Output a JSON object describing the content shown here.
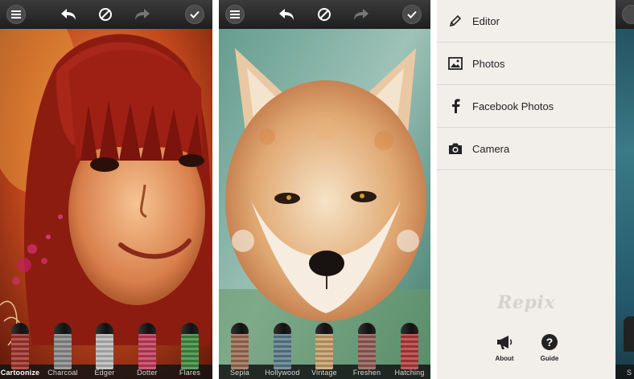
{
  "screens": {
    "cartoonize": {
      "brushes": [
        {
          "label": "Cartoonize",
          "active": true,
          "color": "#a0332a"
        },
        {
          "label": "Charcoal",
          "active": false,
          "color": "#8a8a8a"
        },
        {
          "label": "Edger",
          "active": false,
          "color": "#b8b8b8"
        },
        {
          "label": "Dotter",
          "active": false,
          "color": "#c23b5a"
        },
        {
          "label": "Flares",
          "active": false,
          "color": "#3f8b3e"
        }
      ]
    },
    "fox": {
      "brushes": [
        {
          "label": "Sepia",
          "active": false,
          "color": "#9a6b52"
        },
        {
          "label": "Hollywood",
          "active": false,
          "color": "#5a7a8c"
        },
        {
          "label": "Vintage",
          "active": false,
          "color": "#c6a06a"
        },
        {
          "label": "Freshen",
          "active": false,
          "color": "#8f5d54"
        },
        {
          "label": "Hatching",
          "active": false,
          "color": "#b03a3a"
        }
      ]
    }
  },
  "menu": {
    "items": [
      {
        "label": "Editor",
        "icon": "pencil-icon"
      },
      {
        "label": "Photos",
        "icon": "image-icon"
      },
      {
        "label": "Facebook Photos",
        "icon": "facebook-icon"
      },
      {
        "label": "Camera",
        "icon": "camera-icon"
      }
    ],
    "brand": "Repix",
    "about_label": "About",
    "guide_label": "Guide"
  },
  "edge_panel": {
    "label_fragment": "S"
  },
  "colors": {
    "toolbar": "#2a2a2a",
    "menu_bg": "#f2efeb",
    "menu_text": "#222222"
  }
}
